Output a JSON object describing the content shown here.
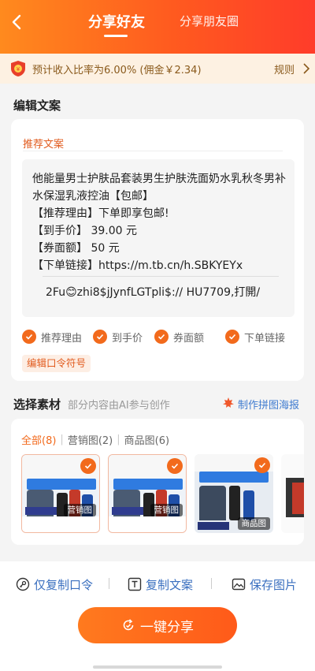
{
  "header": {
    "tab_active": "分享好友",
    "tab_inactive": "分享朋友圈"
  },
  "banner": {
    "text": "预计收入比率为6.00% (佣金￥2.34)",
    "rules": "规则"
  },
  "edit_section": {
    "title": "编辑文案",
    "rec_label": "推荐文案",
    "copy_text": "他能量男士护肤品套装男生护肤洗面奶水乳秋冬男补水保湿乳液控油【包邮】\n【推荐理由】下单即享包邮!\n【到手价】 39.00 元\n【券面额】 50 元\n【下单链接】https://m.tb.cn/h.SBKYEYx",
    "token_text": "2Fu😊zhi8$jJynfLGTpli$:// HU7709,打開/",
    "checks": [
      "推荐理由",
      "到手价",
      "券面额",
      "下单链接"
    ],
    "edit_pwd": "编辑口令符号"
  },
  "material_section": {
    "title": "选择素材",
    "hint": "部分内容由AI参与创作",
    "poster_link": "制作拼图海报",
    "filters": [
      "全部(8)",
      "营销图(2)",
      "商品图(6)"
    ],
    "thumbs": [
      {
        "type": "营销图"
      },
      {
        "type": "营销图"
      },
      {
        "type": "商品图"
      }
    ]
  },
  "actions": {
    "copy_token": "仅复制口令",
    "copy_text": "复制文案",
    "save_image": "保存图片",
    "share": "一键分享"
  },
  "colors": {
    "accent": "#f26a1c",
    "link": "#3f7bd0"
  }
}
